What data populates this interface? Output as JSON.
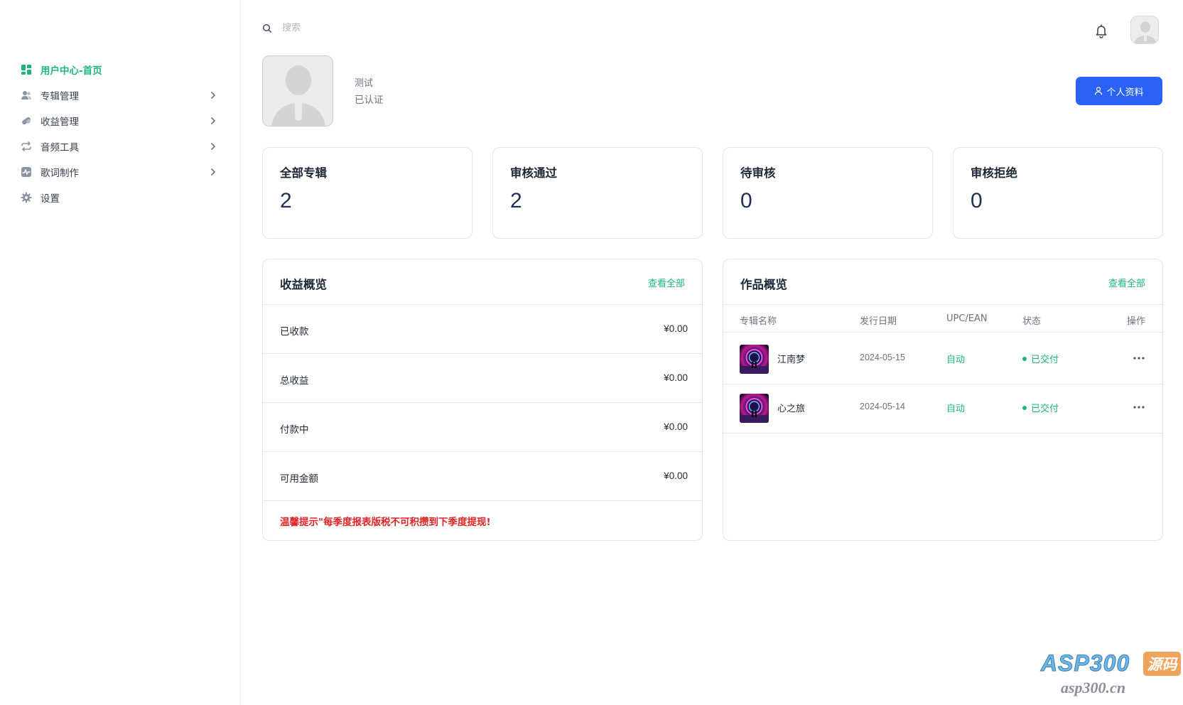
{
  "sidebar": {
    "items": [
      {
        "label": "用户中心-首页",
        "icon": "dashboard-grid-icon",
        "active": true
      },
      {
        "label": "专辑管理",
        "icon": "users-icon",
        "expandable": true
      },
      {
        "label": "收益管理",
        "icon": "pills-icon",
        "expandable": true
      },
      {
        "label": "音频工具",
        "icon": "repeat-arrows-icon",
        "expandable": true
      },
      {
        "label": "歌词制作",
        "icon": "activity-chart-icon",
        "expandable": true
      },
      {
        "label": "设置",
        "icon": "gear-icon"
      }
    ]
  },
  "topbar": {
    "search_placeholder": "搜索"
  },
  "profile": {
    "name": "测试",
    "status": "已认证",
    "button_label": "个人资料"
  },
  "stats": [
    {
      "label": "全部专辑",
      "value": "2"
    },
    {
      "label": "审核通过",
      "value": "2"
    },
    {
      "label": "待审核",
      "value": "0"
    },
    {
      "label": "审核拒绝",
      "value": "0"
    }
  ],
  "income": {
    "title": "收益概览",
    "link": "查看全部",
    "rows": [
      {
        "label": "已收款",
        "value": "¥0.00"
      },
      {
        "label": "总收益",
        "value": "¥0.00"
      },
      {
        "label": "付款中",
        "value": "¥0.00"
      },
      {
        "label": "可用金额",
        "value": "¥0.00"
      }
    ],
    "tip": "温馨提示\"每季度报表版税不可积攒到下季度提现!"
  },
  "works": {
    "title": "作品概览",
    "link": "查看全部",
    "columns": [
      "专辑名称",
      "发行日期",
      "UPC/EAN",
      "状态",
      "操作"
    ],
    "rows": [
      {
        "name": "江南梦",
        "date": "2024-05-15",
        "upc": "自动",
        "status": "已交付"
      },
      {
        "name": "心之旅",
        "date": "2024-05-14",
        "upc": "自动",
        "status": "已交付"
      }
    ]
  },
  "colors": {
    "accent_green": "#1fb47d",
    "primary_blue": "#2962f5",
    "warning_red": "#e02424",
    "stat_number": "#1e3155"
  },
  "watermark": {
    "main": "ASP300",
    "badge": "源码",
    "sub": "asp300.cn"
  }
}
